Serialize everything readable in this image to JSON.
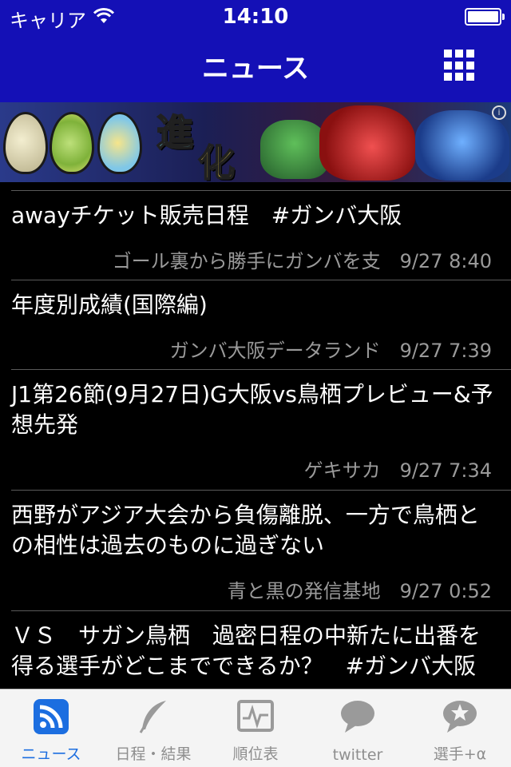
{
  "status_bar": {
    "carrier": "キャリア",
    "time": "14:10"
  },
  "nav": {
    "title": "ニュース",
    "menu_icon": "grid-icon"
  },
  "banner": {
    "text_1": "進",
    "text_2": "化"
  },
  "news": [
    {
      "title": "awayチケット販売日程　#ガンバ大阪",
      "source": "ゴール裏から勝手にガンバを支",
      "time": "9/27 8:40"
    },
    {
      "title": "年度別成績(国際編)",
      "source": "ガンバ大阪データランド",
      "time": "9/27 7:39"
    },
    {
      "title": "J1第26節(9月27日)G大阪vs鳥栖プレビュー&予想先発",
      "source": "ゲキサカ",
      "time": "9/27 7:34"
    },
    {
      "title": "西野がアジア大会から負傷離脱、一方で鳥栖との相性は過去のものに過ぎない",
      "source": "青と黒の発信基地",
      "time": "9/27 0:52"
    },
    {
      "title": "ＶＳ　サガン鳥栖　過密日程の中新たに出番を得る選手がどこまでできるか？　#ガンバ大阪",
      "source": "",
      "time": ""
    }
  ],
  "tabs": [
    {
      "label": "ニュース",
      "icon": "rss-icon",
      "active": true
    },
    {
      "label": "日程・結果",
      "icon": "quill-icon",
      "active": false
    },
    {
      "label": "順位表",
      "icon": "chart-monitor-icon",
      "active": false
    },
    {
      "label": "twitter",
      "icon": "speech-bubble-icon",
      "active": false
    },
    {
      "label": "選手+α",
      "icon": "star-bubble-icon",
      "active": false
    }
  ],
  "colors": {
    "nav_background": "#1410b6",
    "tab_active": "#1c6ee0",
    "tab_inactive": "#8e8e8e"
  }
}
